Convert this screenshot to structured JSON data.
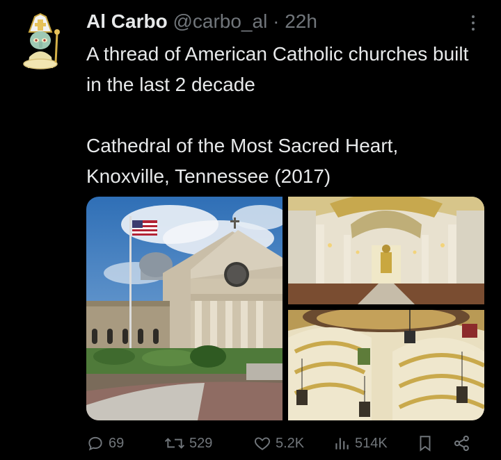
{
  "post": {
    "display_name": "Al Carbo",
    "handle": "@carbo_al",
    "separator": "·",
    "time": "22h",
    "text_line1": "A thread of American Catholic churches built in the last 2 decade",
    "text_line2": "Cathedral of the Most Sacred Heart, Knoxville, Tennessee (2017)"
  },
  "actions": {
    "replies": "69",
    "reposts": "529",
    "likes": "5.2K",
    "views": "514K"
  },
  "colors": {
    "background": "#000000",
    "text": "#e7e9ea",
    "muted": "#71767b"
  },
  "icons": [
    "squidward-pope-avatar",
    "more-icon",
    "reply-icon",
    "repost-icon",
    "like-icon",
    "views-icon",
    "bookmark-icon",
    "share-icon"
  ]
}
